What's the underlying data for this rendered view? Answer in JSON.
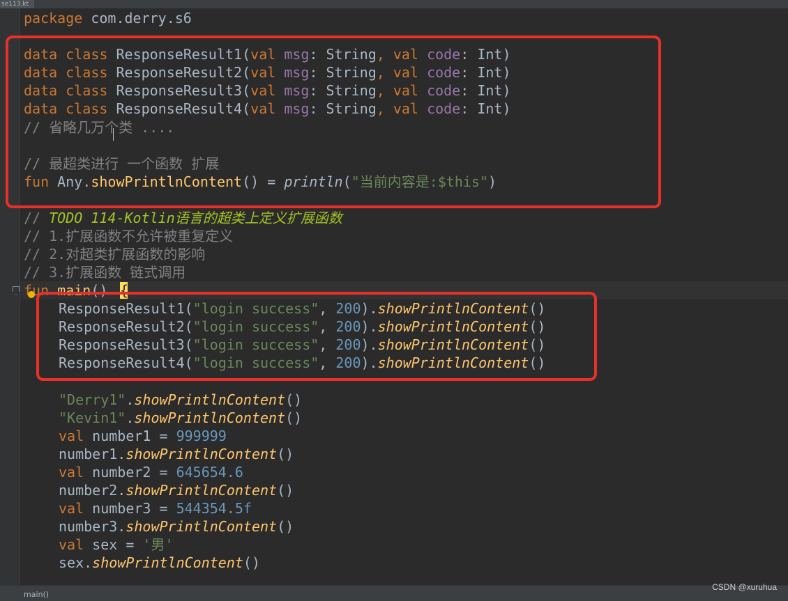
{
  "tab": {
    "label": "se113.kt"
  },
  "status": {
    "breadcrumb": "main()"
  },
  "watermark": "CSDN @xuruhua",
  "code": {
    "package_kw": "package",
    "package_name": " com.derry.s6",
    "data_kw": "data",
    "class_kw": "class",
    "val_kw": "val",
    "fun_kw": "fun",
    "msg_param": "msg",
    "code_param": "code",
    "string_type": "String",
    "int_type": "Int",
    "class1": "ResponseResult1",
    "class2": "ResponseResult2",
    "class3": "ResponseResult3",
    "class4": "ResponseResult4",
    "comment_omit": "// 省略几万个类 ....",
    "comment_super": "// 最超类进行 一个函数 扩展",
    "any_ext": "Any.",
    "ext_fn": "showPrintlnContent",
    "println_fn": "println",
    "template_string": "\"当前内容是:$this\"",
    "comment_prefix": "// ",
    "todo_text": "TODO 114-Kotlin语言的超类上定义扩展函数",
    "comment_1": "// 1.扩展函数不允许被重复定义",
    "comment_2": "// 2.对超类扩展函数的影响",
    "comment_3": "// 3.扩展函数 链式调用",
    "main_fn": "main",
    "login_str": "\"login success\"",
    "code_200": "200",
    "derry_str": "\"Derry1\"",
    "kevin_str": "\"Kevin1\"",
    "number1": "number1",
    "number2": "number2",
    "number3": "number3",
    "sex": "sex",
    "num1_val": "999999",
    "num2_val": "645654.6",
    "num3_val": "544354.5f",
    "sex_val": "'男'"
  }
}
